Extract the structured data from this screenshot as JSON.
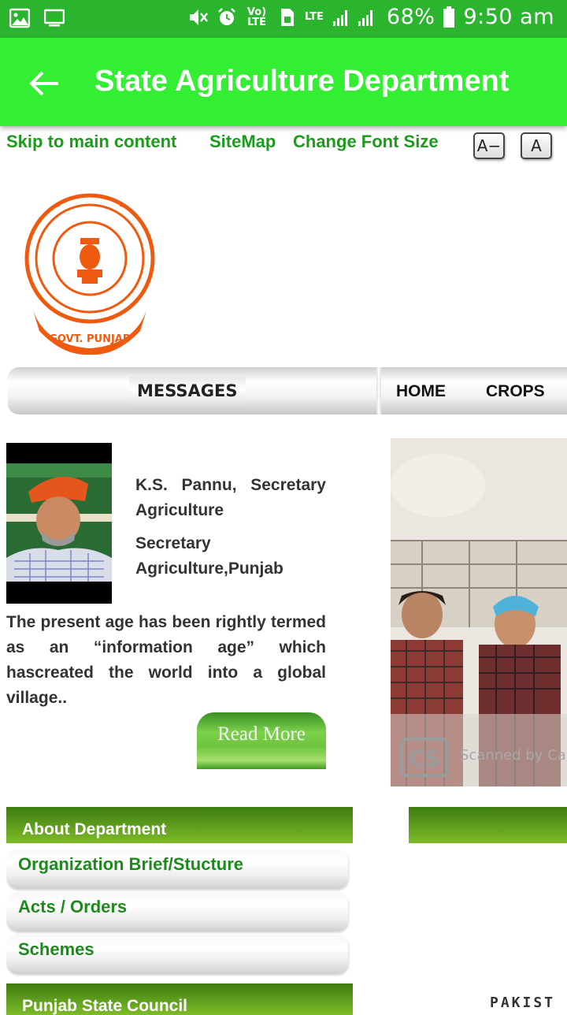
{
  "status_bar": {
    "battery_percent": "68%",
    "time": "9:50 am",
    "volte_label": "Vo) LTE",
    "lte_label": "LTE",
    "icons": [
      "image-icon",
      "monitor-icon",
      "mute-icon",
      "alarm-icon",
      "sim-icon",
      "signal-icon",
      "battery-icon"
    ]
  },
  "app_bar": {
    "title": "State Agriculture Department",
    "back_icon": "arrow-left-icon"
  },
  "utility": {
    "skip_link": "Skip to main content",
    "sitemap_link": "SiteMap",
    "font_size_label": "Change Font Size",
    "font_decrease": "A−",
    "font_normal": "A"
  },
  "nav": {
    "messages": "MESSAGES",
    "home": "HOME",
    "crops": "CROPS"
  },
  "seal": {
    "text": "GOVT. PUNJAB"
  },
  "message": {
    "name": "K.S. Pannu, Secretary Agriculture",
    "role": "Secretary Agriculture,Punjab",
    "body": "The present age has been rightly termed as an “information age” which hascreated the world into a global village..",
    "read_more": "Read More"
  },
  "photo": {
    "watermark_logo": "CS",
    "watermark_text": "Scanned by CamScanner"
  },
  "about": {
    "header": "About Department",
    "items": [
      "Organization Brief/Stucture",
      "Acts / Orders",
      "Schemes"
    ]
  },
  "council": {
    "header": "Punjab State Council"
  },
  "partial_text": "PAKIST",
  "colors": {
    "status_bar": "#2bb52f",
    "app_bar": "#33ee33",
    "link_green": "#1e9a1e",
    "header_green": "#5a9a1c"
  }
}
